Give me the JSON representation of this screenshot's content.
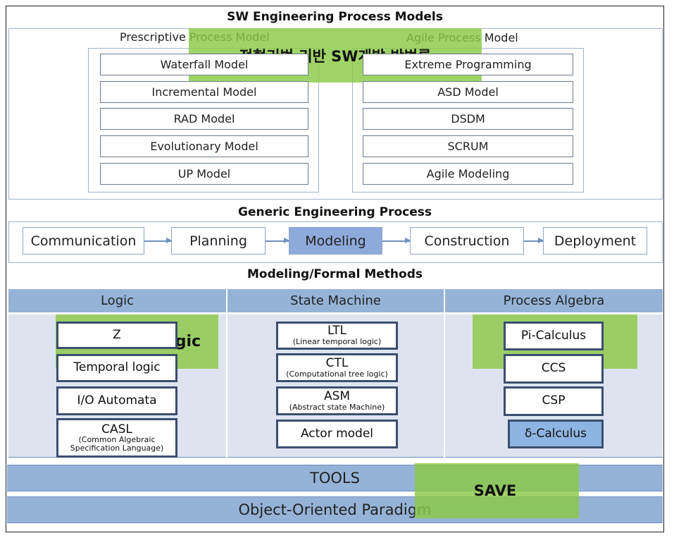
{
  "title": "SW Engineering Process Models",
  "prescriptive": {
    "label": "Prescriptive Process Model",
    "items": [
      "Waterfall Model",
      "Incremental Model",
      "RAD Model",
      "Evolutionary Model",
      "UP Model"
    ]
  },
  "agile": {
    "label": "Agile Process Model",
    "items": [
      "Extreme Programming",
      "ASD Model",
      "DSDM",
      "SCRUM",
      "Agile Modeling"
    ]
  },
  "overlay_top": "정형기법 기반 SW개발 방법론",
  "generic": {
    "title": "Generic Engineering Process",
    "steps": [
      "Communication",
      "Planning",
      "Modeling",
      "Construction",
      "Deployment"
    ],
    "active": "Modeling"
  },
  "formal": {
    "title": "Modeling/Formal Methods",
    "columns": [
      "Logic",
      "State Machine",
      "Process Algebra"
    ],
    "logic": [
      {
        "name": "Z"
      },
      {
        "name": "Temporal logic"
      },
      {
        "name": "I/O Automata"
      },
      {
        "name": "CASL",
        "desc": "(Common Algebraic Specification Language)"
      }
    ],
    "state": [
      {
        "name": "LTL",
        "desc": "(Linear temporal logic)"
      },
      {
        "name": "CTL",
        "desc": "(Computational tree logic)"
      },
      {
        "name": "ASM",
        "desc": "(Abstract state Machine)"
      },
      {
        "name": "Actor model"
      }
    ],
    "algebra": [
      {
        "name": "Pi-Calculus"
      },
      {
        "name": "CCS"
      },
      {
        "name": "CSP"
      },
      {
        "name": "δ-Calculus"
      }
    ]
  },
  "overlay_logic": "GTS-Logic",
  "overlay_algebra": "δ-Calculus",
  "tools": "TOOLS",
  "paradigm": "Object-Oriented Paradigm",
  "overlay_save": "SAVE",
  "colors": {
    "header_blue": "#95b3d7",
    "highlight_blue": "#8eaadb",
    "overlay_green": "#8bc946",
    "body_bg": "#dde4f0"
  }
}
